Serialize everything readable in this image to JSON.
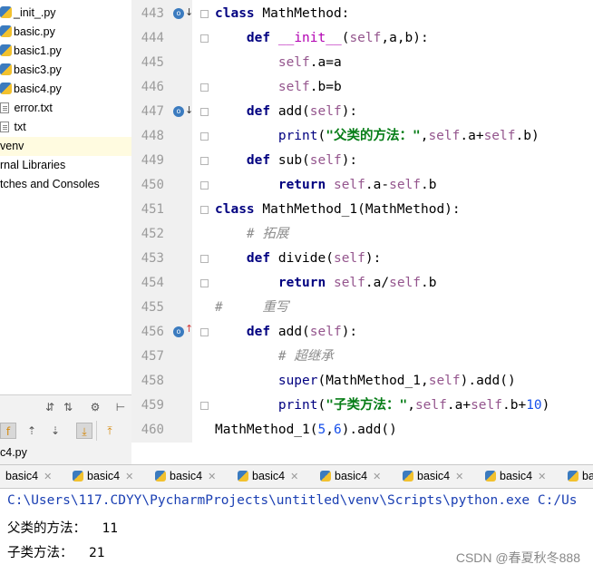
{
  "project_tree": {
    "items": [
      {
        "label": "_init_.py",
        "icon": "python-file-icon"
      },
      {
        "label": "basic.py",
        "icon": "python-file-icon"
      },
      {
        "label": "basic1.py",
        "icon": "python-file-icon"
      },
      {
        "label": "basic3.py",
        "icon": "python-file-icon"
      },
      {
        "label": "basic4.py",
        "icon": "python-file-icon"
      },
      {
        "label": "error.txt",
        "icon": "text-file-icon"
      },
      {
        "label": "txt",
        "icon": "text-file-icon"
      },
      {
        "label": "venv",
        "icon": ""
      },
      {
        "label": "rnal Libraries",
        "icon": ""
      },
      {
        "label": "tches and Consoles",
        "icon": ""
      }
    ],
    "footer_file": "c4.py"
  },
  "editor": {
    "line_numbers": [
      "443",
      "444",
      "445",
      "446",
      "447",
      "448",
      "449",
      "450",
      "451",
      "452",
      "453",
      "454",
      "455",
      "456",
      "457",
      "458",
      "459",
      "460"
    ]
  },
  "run_tabs": [
    "basic4",
    "basic4",
    "basic4",
    "basic4",
    "basic4",
    "basic4",
    "basic4",
    "ba"
  ],
  "console": {
    "command": "C:\\Users\\117.CDYY\\PycharmProjects\\untitled\\venv\\Scripts\\python.exe C:/Us",
    "line1": "父类的方法：  11",
    "line2": "子类方法：  21"
  },
  "watermark": "CSDN @春夏秋冬888",
  "colors": {
    "keyword": "#000080",
    "self": "#94558d",
    "string": "#067d17",
    "number": "#1750eb",
    "comment": "#8c8c8c"
  }
}
